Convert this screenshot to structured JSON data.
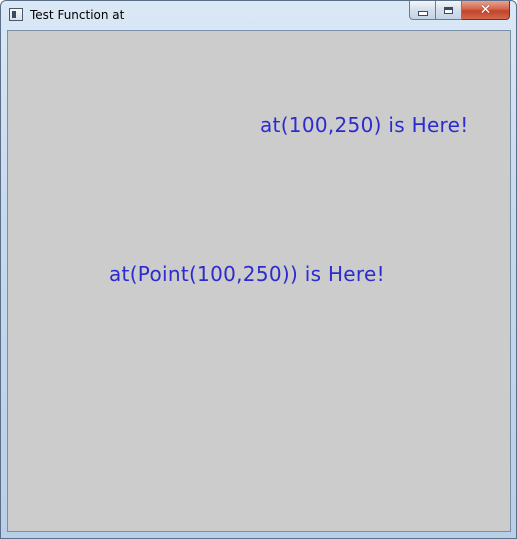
{
  "window": {
    "title": "Test Function at"
  },
  "caption_buttons": {
    "minimize_icon": "minimize-icon",
    "maximize_icon": "maximize-icon",
    "close_icon": "close-icon",
    "close_glyph": "✕"
  },
  "canvas": {
    "background": "#cccccc",
    "text_color": "#2b2bcf",
    "label_1": "at(100,250) is Here!",
    "label_2": "at(Point(100,250)) is Here!"
  }
}
